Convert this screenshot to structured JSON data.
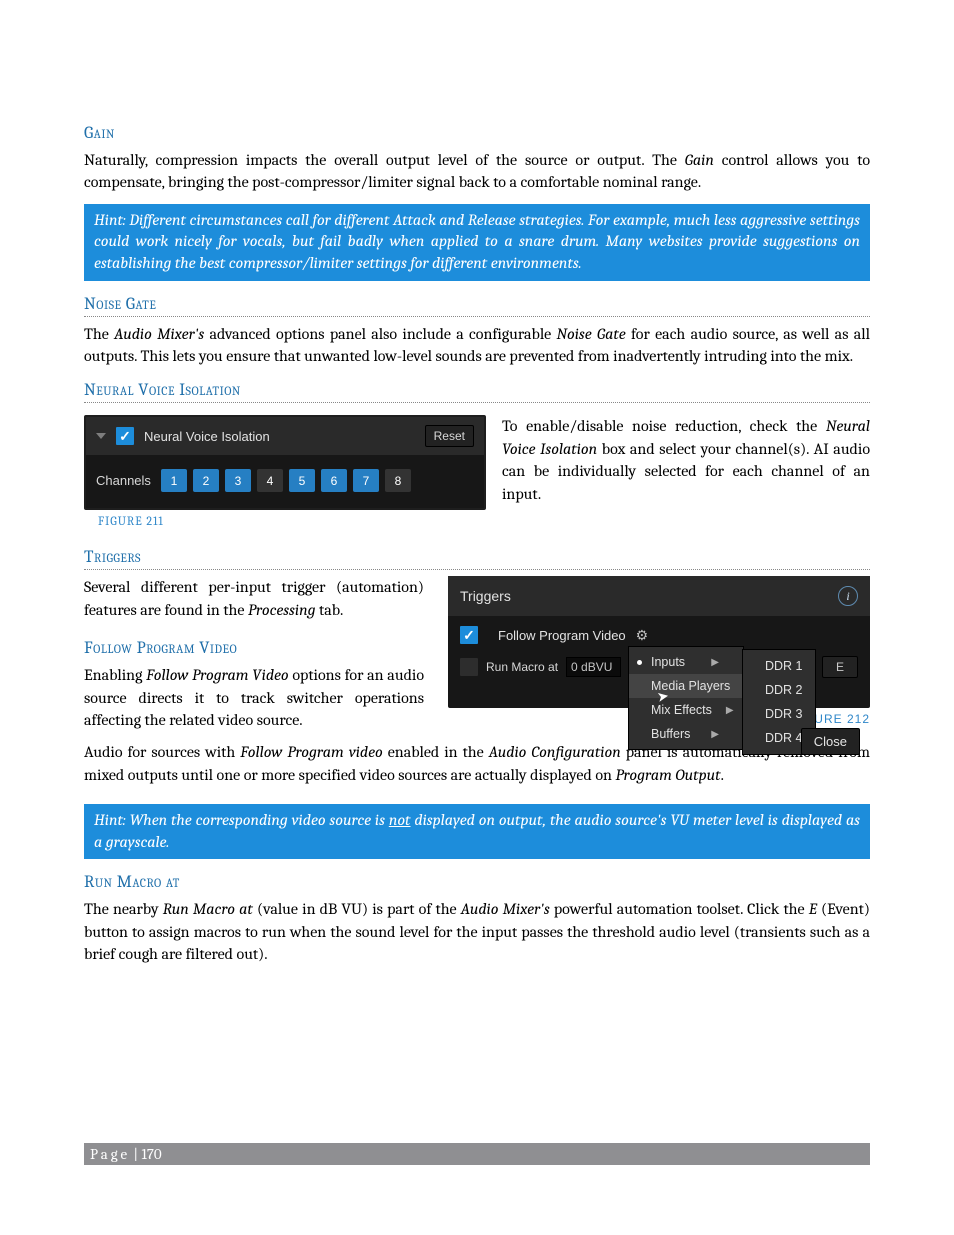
{
  "headings": {
    "gain": "Gain",
    "noise_gate": "Noise Gate",
    "nvi": "Neural Voice Isolation",
    "triggers": "Triggers",
    "follow": "Follow Program Video",
    "run_macro": "Run Macro at"
  },
  "para": {
    "gain1a": "Naturally, compression impacts the overall output level of the source or output.  The ",
    "gain1b": "Gain",
    "gain1c": " control allows you to compensate, bringing the post-compressor/limiter signal back to a comfortable nominal range.",
    "hint1": "Hint:  Different circumstances call for different Attack and Release strategies.  For example, much less aggressive settings could work nicely for vocals, but fail badly when applied to a snare drum.  Many websites provide suggestions on establishing the best compressor/limiter settings for different environments.",
    "noise1a": "The ",
    "noise1b": "Audio Mixer's",
    "noise1c": " advanced options panel also include a configurable ",
    "noise1d": "Noise Gate",
    "noise1e": " for each audio source, as well as all outputs.   This lets you ensure that unwanted low-level sounds are prevented from inadvertently intruding into the mix.",
    "nvi_right_a": "To enable/disable noise reduction, check the ",
    "nvi_right_b": "Neural Voice Isolation",
    "nvi_right_c": " box and select your channel(s).  AI audio can be individually selected for each channel of an input.",
    "trg1a": "Several different per-input trigger (automation) features are found in the ",
    "trg1b": "Processing",
    "trg1c": " tab.",
    "follow1a": "Enabling ",
    "follow1b": "Follow Program Video",
    "follow1c": " options for an audio source directs it to track switcher operations affecting the related video source.",
    "follow2a": "Audio for sources with ",
    "follow2b": "Follow Program video",
    "follow2c": " enabled in the ",
    "follow2d": "Audio Configuration",
    "follow2e": " panel is automatically removed from mixed outputs until one or more specified video sources are actually displayed on ",
    "follow2f": "Program Output",
    "follow2g": ".",
    "hint2a": "Hint: When the corresponding video source is ",
    "hint2b": "not",
    "hint2c": " displayed on output, the audio source's VU meter level is displayed as a grayscale.",
    "run1a": "The nearby ",
    "run1b": "Run Macro at",
    "run1c": " (value in dB VU) is part of the ",
    "run1d": "Audio Mixer's",
    "run1e": " powerful automation toolset.  Click the ",
    "run1f": "E",
    "run1g": " (Event) button to assign macros to run when the sound level for the input passes the threshold audio level (transients such as a brief cough are filtered out)."
  },
  "fig211": {
    "title": "Neural Voice Isolation",
    "reset": "Reset",
    "channels_label": "Channels",
    "channels": [
      "1",
      "2",
      "3",
      "4",
      "5",
      "6",
      "7",
      "8"
    ],
    "channels_on": [
      true,
      true,
      true,
      false,
      true,
      true,
      true,
      false
    ],
    "caption": "FIGURE 211"
  },
  "fig212": {
    "title": "Triggers",
    "follow_label": "Follow Program Video",
    "run_label": "Run Macro at",
    "db_value": "0 dBVU",
    "e_label": "E",
    "close": "Close",
    "menu1": [
      "Inputs",
      "Media Players",
      "Mix Effects",
      "Buffers"
    ],
    "menu2": [
      "DDR 1",
      "DDR 2",
      "DDR 3",
      "DDR 4"
    ],
    "menu1_partial": "ns",
    "caption": "FIGURE 212"
  },
  "footer": {
    "page_label": "Page",
    "sep": " | ",
    "num": "170"
  }
}
